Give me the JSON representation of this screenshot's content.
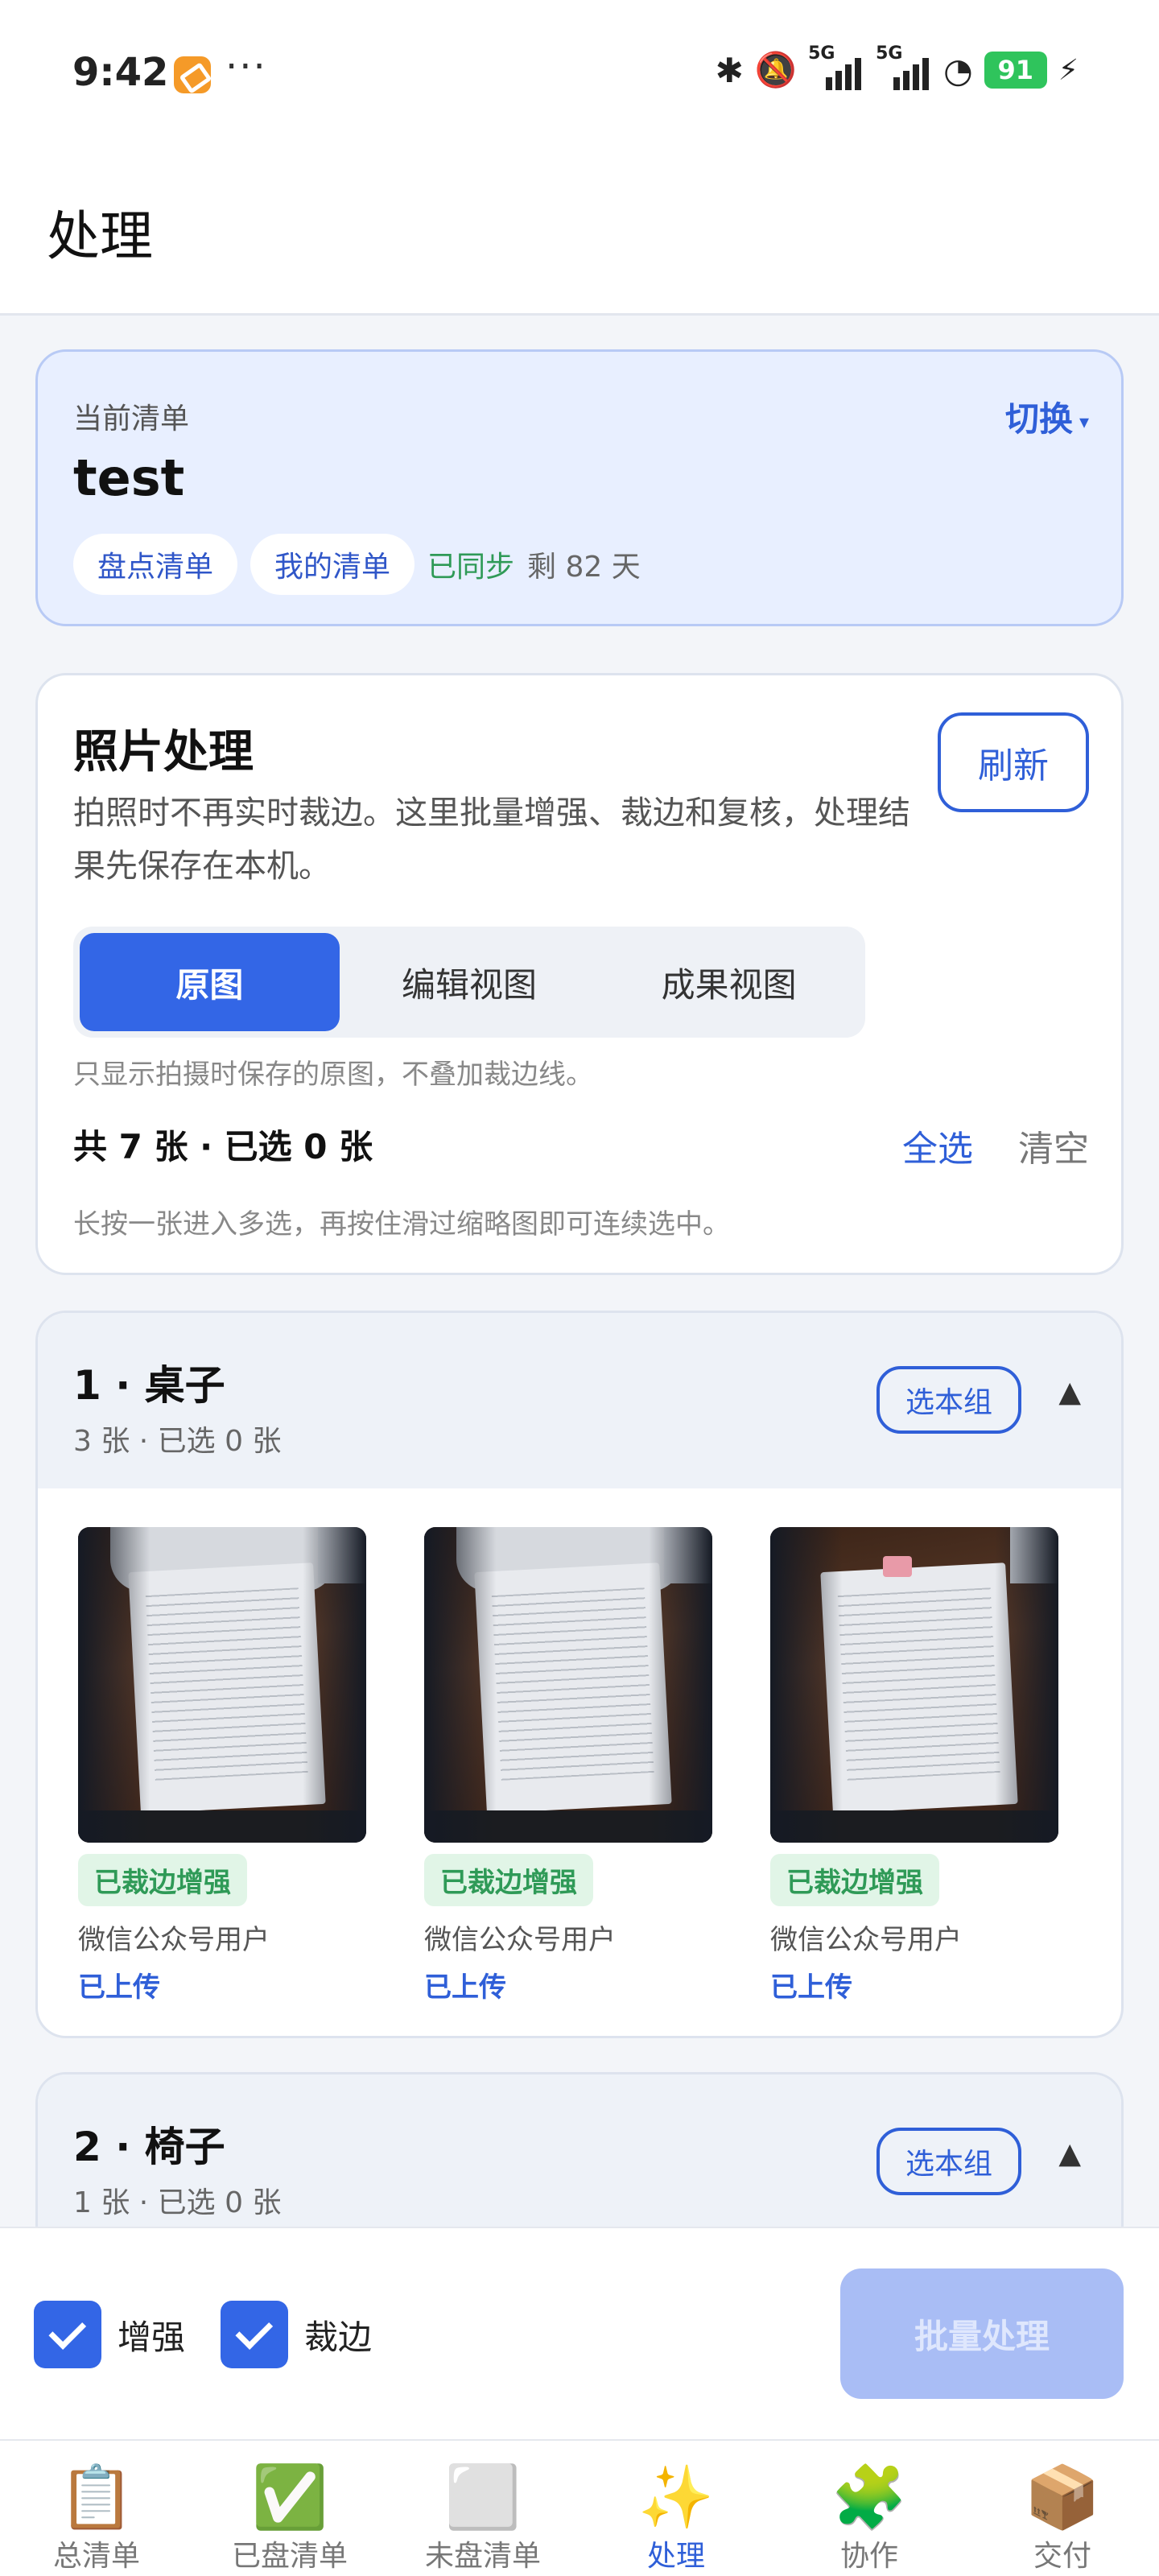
{
  "status_bar": {
    "time": "9:42",
    "dots": "···",
    "network_1": "5G",
    "network_2": "5G",
    "battery": "91",
    "icons": [
      "bluetooth-icon",
      "mute-bell-icon",
      "signal-icon",
      "signal-icon",
      "wifi-icon",
      "battery-icon",
      "charging-icon"
    ]
  },
  "header": {
    "title": "处理"
  },
  "current_list": {
    "label": "当前清单",
    "switch_label": "切换",
    "switch_caret": "▾",
    "name": "test",
    "tags": [
      "盘点清单",
      "我的清单"
    ],
    "sync_status": "已同步",
    "remaining": "剩 82 天"
  },
  "photo_processing": {
    "title": "照片处理",
    "description": "拍照时不再实时裁边。这里批量增强、裁边和复核，处理结果先保存在本机。",
    "refresh_label": "刷新",
    "tabs": [
      "原图",
      "编辑视图",
      "成果视图"
    ],
    "active_tab": "原图",
    "tab_hint": "只显示拍摄时保存的原图，不叠加裁边线。",
    "count_text": "共 7 张 · 已选 0 张",
    "select_all_label": "全选",
    "clear_label": "清空",
    "multi_select_hint": "长按一张进入多选，再按住滑过缩略图即可连续选中。"
  },
  "groups": [
    {
      "title": "1 · 桌子",
      "subtitle": "3 张 · 已选 0 张",
      "select_group_label": "选本组",
      "toggle": "▲",
      "photos": [
        {
          "status": "已裁边增强",
          "uploader": "微信公众号用户",
          "upload_status": "已上传"
        },
        {
          "status": "已裁边增强",
          "uploader": "微信公众号用户",
          "upload_status": "已上传"
        },
        {
          "status": "已裁边增强",
          "uploader": "微信公众号用户",
          "upload_status": "已上传"
        }
      ]
    },
    {
      "title": "2 · 椅子",
      "subtitle": "1 张 · 已选 0 张",
      "select_group_label": "选本组",
      "toggle": "▲"
    }
  ],
  "action_bar": {
    "enhance_label": "增强",
    "enhance_checked": true,
    "crop_label": "裁边",
    "crop_checked": true,
    "batch_label": "批量处理"
  },
  "bottom_nav": {
    "items": [
      {
        "label": "总清单",
        "icon": "📋"
      },
      {
        "label": "已盘清单",
        "icon": "✅"
      },
      {
        "label": "未盘清单",
        "icon": "⬜"
      },
      {
        "label": "处理",
        "icon": "✨"
      },
      {
        "label": "协作",
        "icon": "🧩"
      },
      {
        "label": "交付",
        "icon": "📦"
      }
    ],
    "active_index": 3
  },
  "colors": {
    "accent": "#3366e6",
    "success": "#2f9a57",
    "card_highlight": "#e8efff"
  }
}
